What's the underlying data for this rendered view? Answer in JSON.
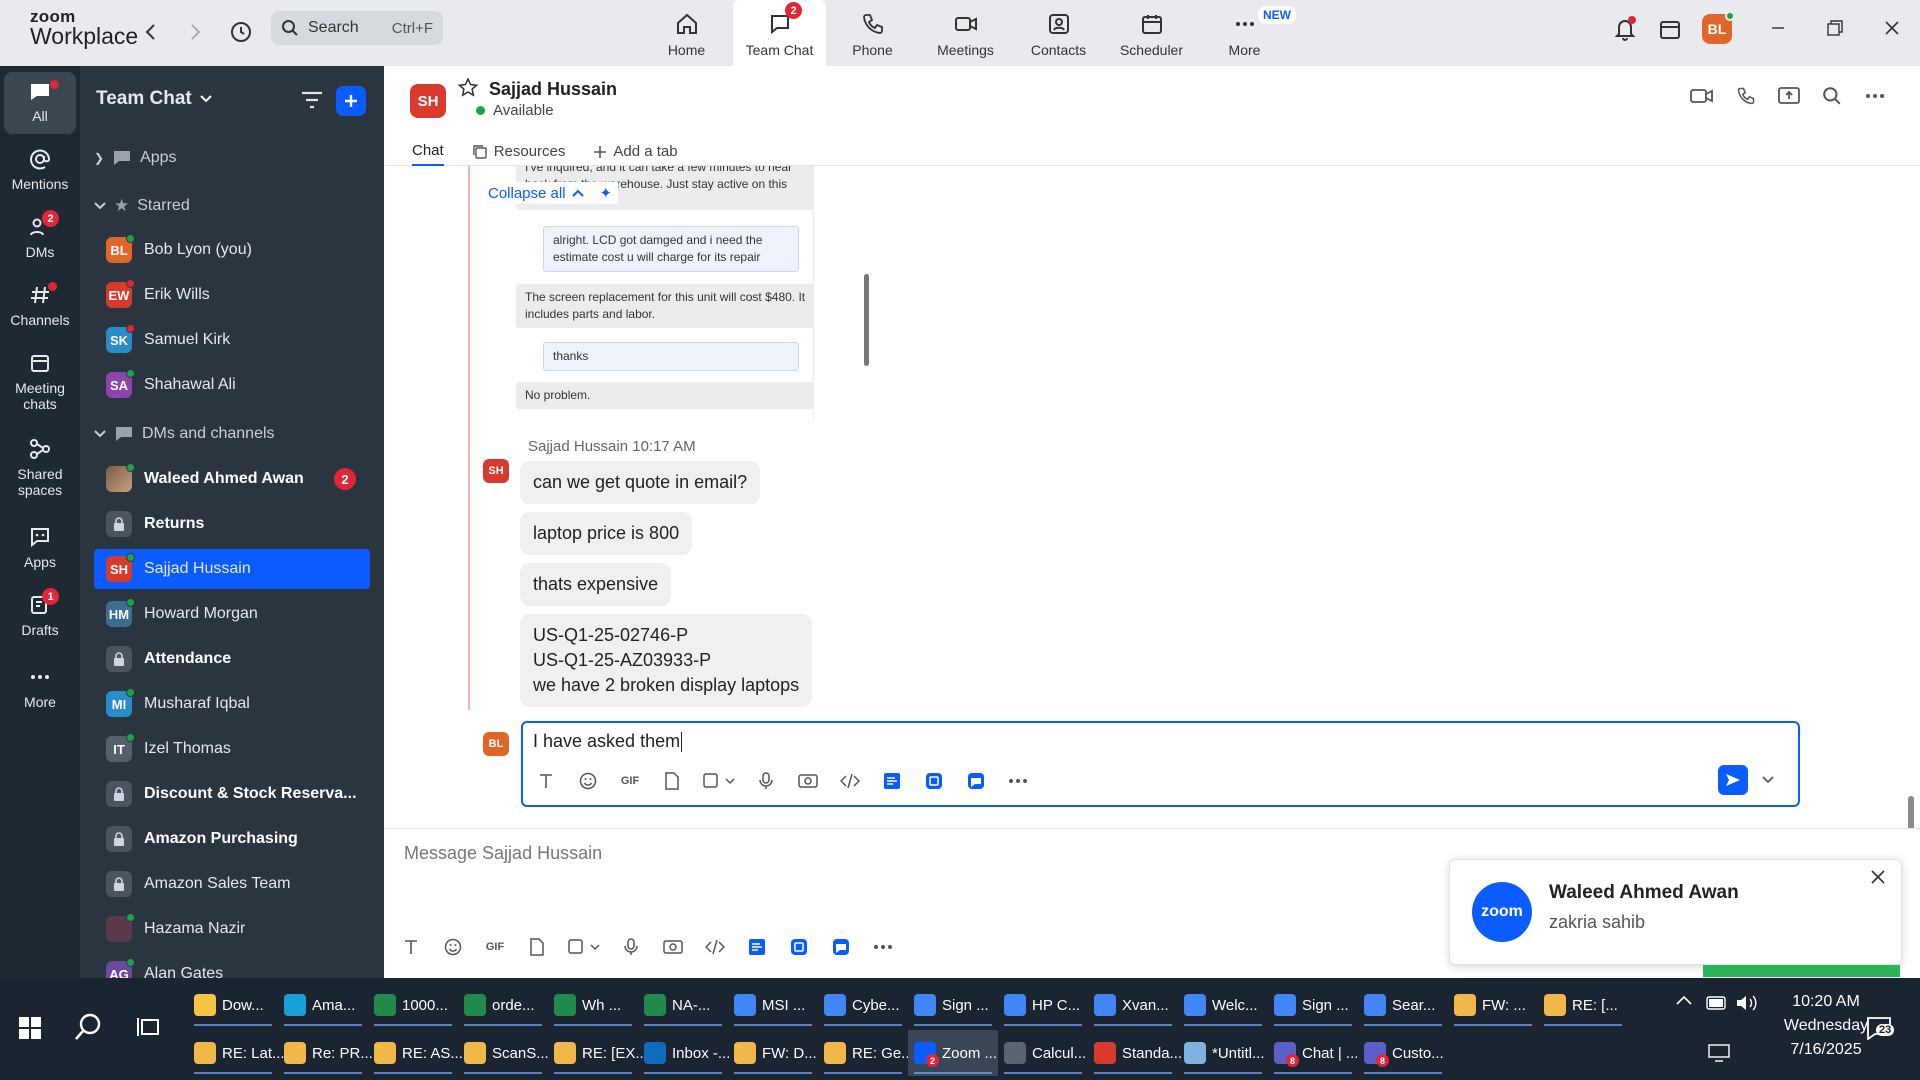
{
  "app": {
    "logo_line1": "zoom",
    "logo_line2": "Workplace"
  },
  "topbar": {
    "search_label": "Search",
    "search_shortcut": "Ctrl+F",
    "nav": [
      {
        "label": "Home",
        "icon": "home-icon"
      },
      {
        "label": "Team Chat",
        "icon": "chat-icon",
        "badge": "2",
        "active": true
      },
      {
        "label": "Phone",
        "icon": "phone-icon"
      },
      {
        "label": "Meetings",
        "icon": "video-icon"
      },
      {
        "label": "Contacts",
        "icon": "contacts-icon"
      },
      {
        "label": "Scheduler",
        "icon": "calendar-icon"
      },
      {
        "label": "More",
        "icon": "more-icon",
        "pill": "NEW"
      }
    ],
    "user_initials": "BL"
  },
  "rail": [
    {
      "label": "All",
      "icon": "chat-bubble-icon",
      "active": true
    },
    {
      "label": "Mentions",
      "icon": "at-icon"
    },
    {
      "label": "DMs",
      "icon": "people-icon",
      "badge": "2"
    },
    {
      "label": "Channels",
      "icon": "hash-icon"
    },
    {
      "label": "Meeting chats",
      "icon": "calendar-icon"
    },
    {
      "label": "Shared spaces",
      "icon": "share-icon"
    },
    {
      "label": "Apps",
      "icon": "apps-icon"
    },
    {
      "label": "Drafts",
      "icon": "draft-icon",
      "badge": "1"
    },
    {
      "label": "More",
      "icon": "more-icon"
    }
  ],
  "sidebar": {
    "title": "Team Chat",
    "sections": {
      "apps": "Apps",
      "starred": "Starred",
      "dms": "DMs and channels"
    },
    "starred": [
      {
        "name": "Bob Lyon (you)",
        "initials": "BL",
        "color": "#e0662a"
      },
      {
        "name": "Erik Wills",
        "initials": "EW",
        "color": "#d93a2e"
      },
      {
        "name": "Samuel Kirk",
        "initials": "SK",
        "color": "#2a8cc9"
      },
      {
        "name": "Shahawal Ali",
        "initials": "SA",
        "color": "#8e44ad"
      }
    ],
    "channels": [
      {
        "name": "Waleed Ahmed Awan",
        "bold": true,
        "badge": "2",
        "photo": true
      },
      {
        "name": "Returns",
        "bold": true,
        "lock": true
      },
      {
        "name": "Sajjad Hussain",
        "initials": "SH",
        "color": "#d93a2e",
        "selected": true
      },
      {
        "name": "Howard Morgan",
        "initials": "HM",
        "color": "#3c6e8f"
      },
      {
        "name": "Attendance",
        "bold": true,
        "lock": true
      },
      {
        "name": "Musharaf Iqbal",
        "initials": "MI",
        "color": "#2a8cc9"
      },
      {
        "name": "Izel Thomas",
        "initials": "IT",
        "color": "#55606c"
      },
      {
        "name": "Discount & Stock Reserva...",
        "bold": true,
        "lock": true
      },
      {
        "name": "Amazon Purchasing",
        "bold": true,
        "lock": true
      },
      {
        "name": "Amazon Sales Team",
        "lock": true
      },
      {
        "name": "Hazama Nazir",
        "initials": "",
        "color": "#5a3a4a"
      },
      {
        "name": "Alan Gates",
        "initials": "AG",
        "color": "#6b4aa0"
      }
    ]
  },
  "chat": {
    "initials": "SH",
    "name": "Sajjad Hussain",
    "status": "Available",
    "tabs": [
      "Chat",
      "Resources",
      "Add a tab"
    ],
    "quoted": {
      "partial_line1": "I've inquired, and it can take a few minutes to hear",
      "partial_line2": "back from the warehouse. Just stay active on this",
      "collapse": "Collapse all",
      "msgs": [
        "alright. LCD got damged and i need the estimate cost u will charge for its repair",
        "The screen replacement for this unit will cost $480. It includes parts and labor.",
        "thanks",
        "No problem."
      ]
    },
    "sender": "Sajjad Hussain",
    "time": "10:17 AM",
    "sender_initials": "SH",
    "messages": [
      "can we get quote in email?",
      "laptop price is 800",
      "thats expensive"
    ],
    "multi": [
      "US-Q1-25-02746-P",
      "US-Q1-25-AZ03933-P",
      "we have 2 broken display laptops"
    ],
    "reply_initials": "BL",
    "draft": "I have asked them",
    "bottom_placeholder": "Message Sajjad Hussain"
  },
  "toast": {
    "logo": "zoom",
    "title": "Waleed Ahmed Awan",
    "body": "zakria sahib"
  },
  "taskbar": {
    "row1": [
      {
        "label": "Dow...",
        "color": "#f4c542"
      },
      {
        "label": "Ama...",
        "color": "#1aa0d8"
      },
      {
        "label": "1000...",
        "color": "#1f8a4c"
      },
      {
        "label": "orde...",
        "color": "#1f8a4c"
      },
      {
        "label": "Wh ...",
        "color": "#1f8a4c"
      },
      {
        "label": "NA-...",
        "color": "#1f8a4c"
      },
      {
        "label": "MSI ...",
        "color": "#4285f4"
      },
      {
        "label": "Cybe...",
        "color": "#4285f4"
      },
      {
        "label": "Sign ...",
        "color": "#4285f4"
      },
      {
        "label": "HP C...",
        "color": "#4285f4"
      },
      {
        "label": "Xvan...",
        "color": "#4285f4"
      },
      {
        "label": "Welc...",
        "color": "#4285f4"
      },
      {
        "label": "Sign ...",
        "color": "#4285f4"
      },
      {
        "label": "Sear...",
        "color": "#4285f4"
      },
      {
        "label": "FW: ...",
        "color": "#f0b84a"
      },
      {
        "label": "RE: [...",
        "color": "#f0b84a"
      }
    ],
    "row2": [
      {
        "label": "RE: Lat...",
        "color": "#f0b84a"
      },
      {
        "label": "Re: PR...",
        "color": "#f0b84a"
      },
      {
        "label": "RE: AS...",
        "color": "#f0b84a"
      },
      {
        "label": "ScanS...",
        "color": "#f0b84a"
      },
      {
        "label": "RE: [EX...",
        "color": "#f0b84a"
      },
      {
        "label": "Inbox -...",
        "color": "#0f6cbd"
      },
      {
        "label": "FW: D...",
        "color": "#f0b84a"
      },
      {
        "label": "RE: Ge...",
        "color": "#f0b84a"
      },
      {
        "label": "Zoom ...",
        "color": "#0b5cff",
        "active": true,
        "badge": "2"
      },
      {
        "label": "Calcul...",
        "color": "#5a6470"
      },
      {
        "label": "Standa...",
        "color": "#d93a2e"
      },
      {
        "label": "*Untitl...",
        "color": "#7fb2e0"
      },
      {
        "label": "Chat | ...",
        "color": "#5b5fc7",
        "badge": "8"
      },
      {
        "label": "Custo...",
        "color": "#5b5fc7",
        "badge": "8"
      }
    ],
    "time": "10:20 AM",
    "day": "Wednesday",
    "date": "7/16/2025",
    "notif_count": "23"
  }
}
